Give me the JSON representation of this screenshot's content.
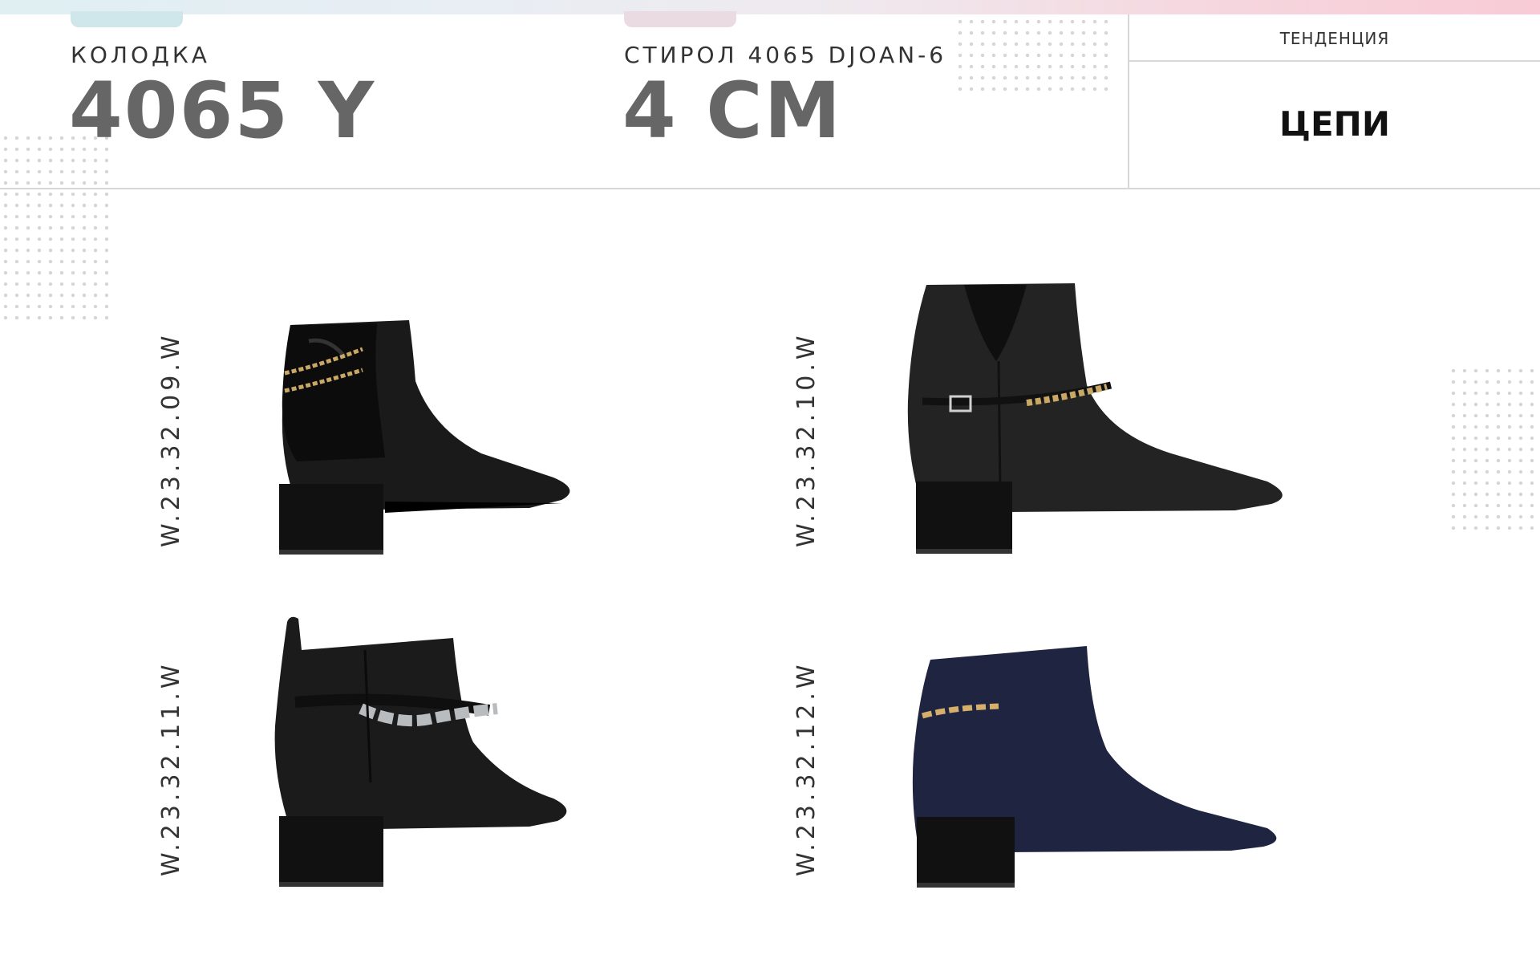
{
  "header": {
    "last_label": "КОЛОДКА",
    "last_value": "4065 Y",
    "heel_label": "СТИРОЛ 4065 DJOAN-6",
    "heel_value": "4 СМ",
    "trend_label": "ТЕНДЕНЦИЯ",
    "trend_value": "ЦЕПИ"
  },
  "products": [
    {
      "code": "W.23.32.09.W"
    },
    {
      "code": "W.23.32.10.W"
    },
    {
      "code": "W.23.32.11.W"
    },
    {
      "code": "W.23.32.12.W"
    }
  ],
  "colors": {
    "leather": "#1c1c1c",
    "navy_suede": "#1f2540",
    "gold_chain": "#c9a866",
    "silver_chain": "#b9bcbf",
    "value_grey": "#666666"
  }
}
